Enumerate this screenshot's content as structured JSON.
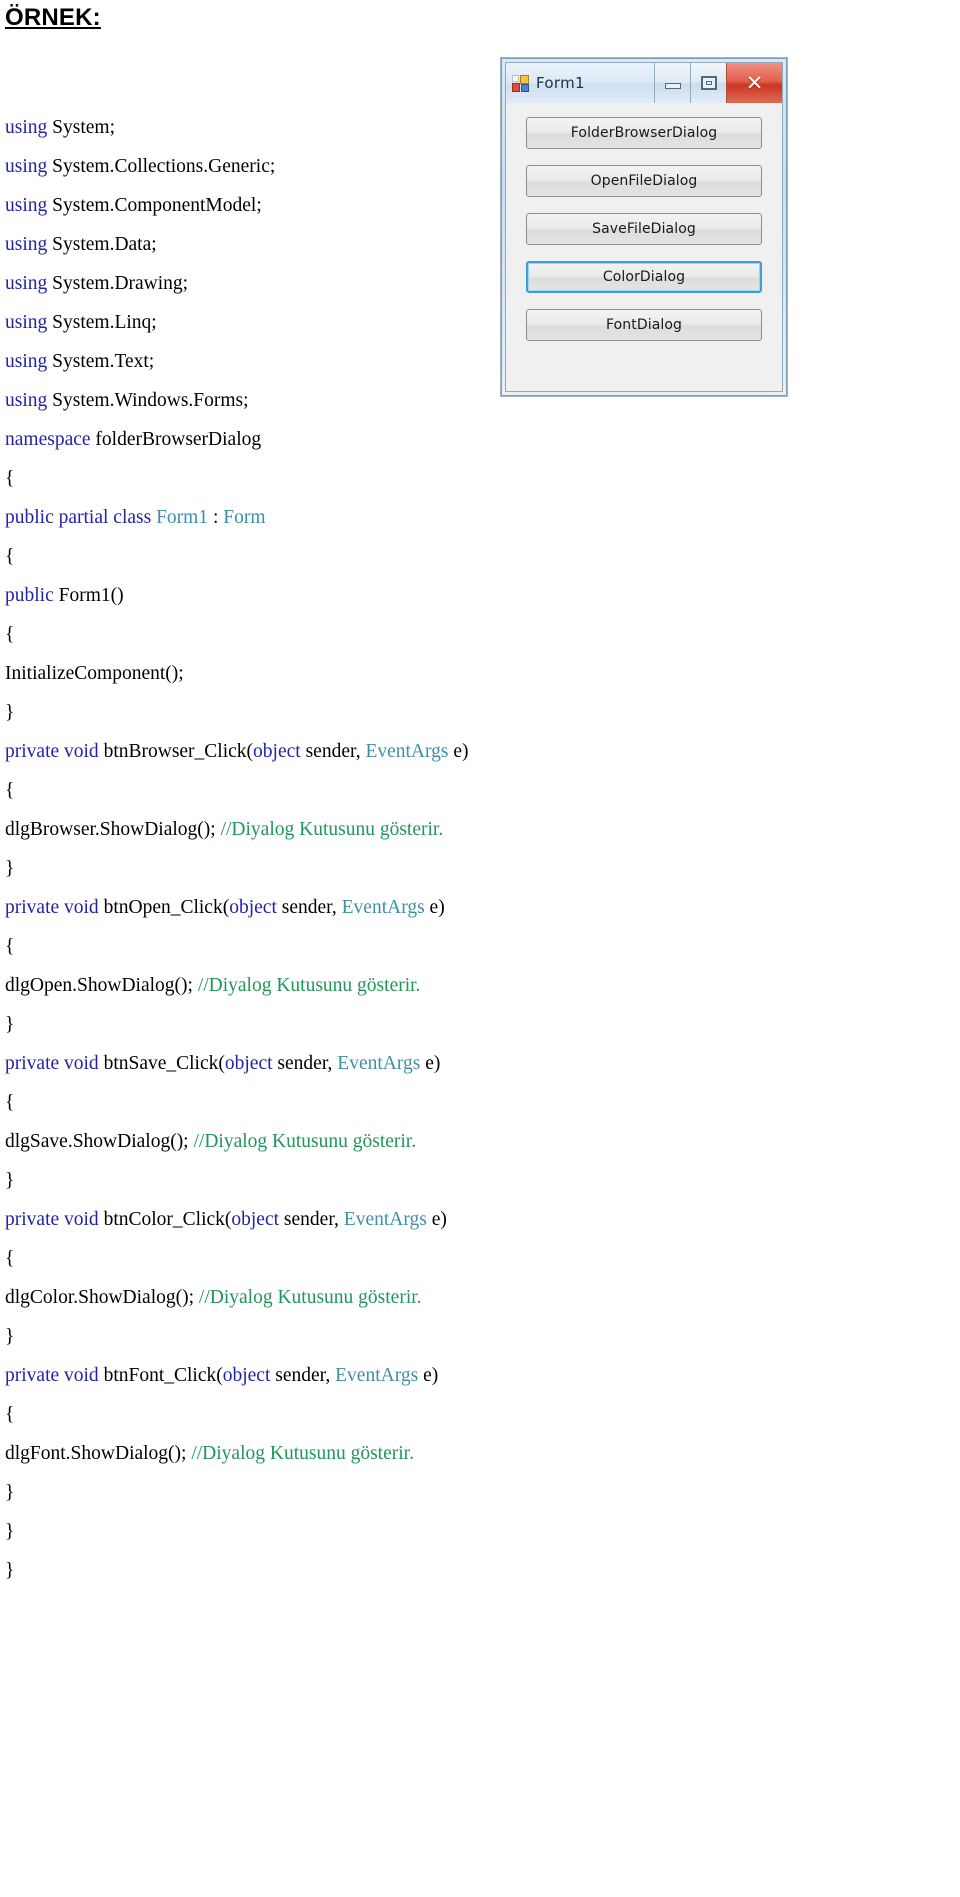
{
  "document": {
    "heading": "ÖRNEK:"
  },
  "code": {
    "lines": [
      [
        {
          "t": "using ",
          "c": "kw"
        },
        {
          "t": "System;",
          "c": "pln"
        }
      ],
      [
        {
          "t": "using ",
          "c": "kw"
        },
        {
          "t": "System.Collections.Generic;",
          "c": "pln"
        }
      ],
      [
        {
          "t": "using ",
          "c": "kw"
        },
        {
          "t": "System.ComponentModel;",
          "c": "pln"
        }
      ],
      [
        {
          "t": "using ",
          "c": "kw"
        },
        {
          "t": "System.Data;",
          "c": "pln"
        }
      ],
      [
        {
          "t": "using ",
          "c": "kw"
        },
        {
          "t": "System.Drawing;",
          "c": "pln"
        }
      ],
      [
        {
          "t": "using ",
          "c": "kw"
        },
        {
          "t": "System.Linq;",
          "c": "pln"
        }
      ],
      [
        {
          "t": "using ",
          "c": "kw"
        },
        {
          "t": "System.Text;",
          "c": "pln"
        }
      ],
      [
        {
          "t": "using ",
          "c": "kw"
        },
        {
          "t": "System.Windows.Forms;",
          "c": "pln"
        }
      ],
      [
        {
          "t": "namespace ",
          "c": "kw"
        },
        {
          "t": "folderBrowserDialog",
          "c": "pln"
        }
      ],
      [
        {
          "t": "{",
          "c": "pln"
        }
      ],
      [
        {
          "t": "public partial class ",
          "c": "kw"
        },
        {
          "t": "Form1",
          "c": "typ"
        },
        {
          "t": " : ",
          "c": "pln"
        },
        {
          "t": "Form",
          "c": "typ"
        }
      ],
      [
        {
          "t": "{",
          "c": "pln"
        }
      ],
      [
        {
          "t": "public ",
          "c": "kw"
        },
        {
          "t": "Form1()",
          "c": "pln"
        }
      ],
      [
        {
          "t": "{",
          "c": "pln"
        }
      ],
      [
        {
          "t": "InitializeComponent();",
          "c": "pln"
        }
      ],
      [
        {
          "t": "}",
          "c": "pln"
        }
      ],
      [
        {
          "t": "private void ",
          "c": "kw"
        },
        {
          "t": "btnBrowser_Click(",
          "c": "pln"
        },
        {
          "t": "object",
          "c": "kw"
        },
        {
          "t": " sender, ",
          "c": "pln"
        },
        {
          "t": "EventArgs",
          "c": "typ"
        },
        {
          "t": " e)",
          "c": "pln"
        }
      ],
      [
        {
          "t": "{",
          "c": "pln"
        }
      ],
      [
        {
          "t": "dlgBrowser.ShowDialog(); ",
          "c": "pln"
        },
        {
          "t": "//Diyalog Kutusunu gösterir.",
          "c": "cmt"
        }
      ],
      [
        {
          "t": "}",
          "c": "pln"
        }
      ],
      [
        {
          "t": "private void ",
          "c": "kw"
        },
        {
          "t": "btnOpen_Click(",
          "c": "pln"
        },
        {
          "t": "object",
          "c": "kw"
        },
        {
          "t": " sender, ",
          "c": "pln"
        },
        {
          "t": "EventArgs",
          "c": "typ"
        },
        {
          "t": " e)",
          "c": "pln"
        }
      ],
      [
        {
          "t": "{",
          "c": "pln"
        }
      ],
      [
        {
          "t": "dlgOpen.ShowDialog(); ",
          "c": "pln"
        },
        {
          "t": "//Diyalog Kutusunu gösterir.",
          "c": "cmt"
        }
      ],
      [
        {
          "t": "}",
          "c": "pln"
        }
      ],
      [
        {
          "t": "private void ",
          "c": "kw"
        },
        {
          "t": "btnSave_Click(",
          "c": "pln"
        },
        {
          "t": "object",
          "c": "kw"
        },
        {
          "t": " sender, ",
          "c": "pln"
        },
        {
          "t": "EventArgs",
          "c": "typ"
        },
        {
          "t": " e)",
          "c": "pln"
        }
      ],
      [
        {
          "t": "{",
          "c": "pln"
        }
      ],
      [
        {
          "t": "dlgSave.ShowDialog(); ",
          "c": "pln"
        },
        {
          "t": "//Diyalog Kutusunu gösterir.",
          "c": "cmt"
        }
      ],
      [
        {
          "t": "}",
          "c": "pln"
        }
      ],
      [
        {
          "t": "private void ",
          "c": "kw"
        },
        {
          "t": "btnColor_Click(",
          "c": "pln"
        },
        {
          "t": "object",
          "c": "kw"
        },
        {
          "t": " sender, ",
          "c": "pln"
        },
        {
          "t": "EventArgs",
          "c": "typ"
        },
        {
          "t": " e)",
          "c": "pln"
        }
      ],
      [
        {
          "t": "{",
          "c": "pln"
        }
      ],
      [
        {
          "t": "dlgColor.ShowDialog(); ",
          "c": "pln"
        },
        {
          "t": "//Diyalog Kutusunu gösterir.",
          "c": "cmt"
        }
      ],
      [
        {
          "t": "}",
          "c": "pln"
        }
      ],
      [
        {
          "t": "private void ",
          "c": "kw"
        },
        {
          "t": "btnFont_Click(",
          "c": "pln"
        },
        {
          "t": "object",
          "c": "kw"
        },
        {
          "t": " sender, ",
          "c": "pln"
        },
        {
          "t": "EventArgs",
          "c": "typ"
        },
        {
          "t": " e)",
          "c": "pln"
        }
      ],
      [
        {
          "t": "{",
          "c": "pln"
        }
      ],
      [
        {
          "t": "dlgFont.ShowDialog(); ",
          "c": "pln"
        },
        {
          "t": "//Diyalog Kutusunu gösterir.",
          "c": "cmt"
        }
      ],
      [
        {
          "t": "}",
          "c": "pln"
        }
      ],
      [
        {
          "t": "}",
          "c": "pln"
        }
      ],
      [
        {
          "t": "}",
          "c": "pln"
        }
      ]
    ],
    "colors": {
      "keyword": "#2222aa",
      "type": "#3f8fa6",
      "comment": "#20965a",
      "plain": "#000000"
    }
  },
  "form_screenshot": {
    "title": "Form1",
    "window_icon": "form-app-icon",
    "titlebar_buttons": [
      {
        "name": "minimize",
        "glyph": "minimize-icon"
      },
      {
        "name": "maximize",
        "glyph": "maximize-icon"
      },
      {
        "name": "close",
        "glyph": "✕"
      }
    ],
    "buttons": [
      {
        "label": "FolderBrowserDialog",
        "focused": false
      },
      {
        "label": "OpenFileDialog",
        "focused": false
      },
      {
        "label": "SaveFileDialog",
        "focused": false
      },
      {
        "label": "ColorDialog",
        "focused": true
      },
      {
        "label": "FontDialog",
        "focused": false
      }
    ],
    "accent_focus_color": "#3c9fd6",
    "close_button_color": "#cc3620"
  }
}
